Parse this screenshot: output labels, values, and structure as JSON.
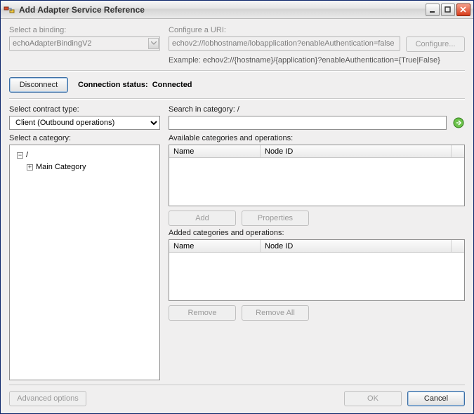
{
  "window": {
    "title": "Add Adapter Service Reference"
  },
  "binding": {
    "label": "Select a binding:",
    "value": "echoAdapterBindingV2"
  },
  "uri": {
    "label": "Configure a URI:",
    "value": "echov2://lobhostname/lobapplication?enableAuthentication=false",
    "example": "Example: echov2://{hostname}/{application}?enableAuthentication={True|False}",
    "configure_label": "Configure..."
  },
  "connection": {
    "disconnect_label": "Disconnect",
    "status_label": "Connection status:",
    "status_value": "Connected"
  },
  "contract": {
    "label": "Select contract type:",
    "value": "Client (Outbound operations)"
  },
  "search": {
    "label": "Search in category: /",
    "value": ""
  },
  "category": {
    "label": "Select a category:",
    "root": "/",
    "child1": "Main Category"
  },
  "available": {
    "label": "Available categories and operations:",
    "col_name": "Name",
    "col_nodeid": "Node ID",
    "add_label": "Add",
    "props_label": "Properties"
  },
  "added": {
    "label": "Added categories and operations:",
    "col_name": "Name",
    "col_nodeid": "Node ID",
    "remove_label": "Remove",
    "removeall_label": "Remove All"
  },
  "footer": {
    "advanced_label": "Advanced options",
    "ok_label": "OK",
    "cancel_label": "Cancel"
  }
}
